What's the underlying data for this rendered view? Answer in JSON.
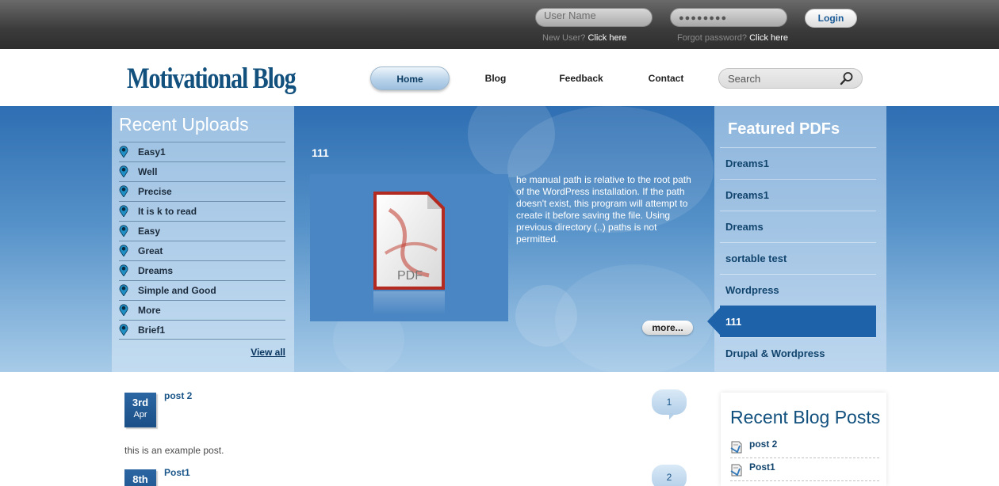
{
  "topbar": {
    "username_placeholder": "User Name",
    "password_mask": "●●●●●●●●",
    "login_label": "Login",
    "new_user_text": "New User?",
    "new_user_link": "Click here",
    "forgot_text": "Forgot password?",
    "forgot_link": "Click here"
  },
  "header": {
    "logo": "Motivational Blog",
    "nav": [
      "Home",
      "Blog",
      "Feedback",
      "Contact"
    ],
    "active_nav": "Home",
    "search_placeholder": "Search"
  },
  "recent_uploads": {
    "title": "Recent Uploads",
    "items": [
      "Easy1",
      "Well",
      "Precise",
      "It is k to read",
      "Easy",
      "Great",
      "Dreams",
      "Simple and Good",
      "More",
      "Brief1"
    ],
    "view_all": "View all"
  },
  "feature": {
    "title": "111",
    "pdf_icon_label": "PDF",
    "text": "he manual path is relative to the root path of the WordPress installation. If the path doesn't exist, this program will attempt to create it before saving the file. Using previous directory (..) paths is not permitted.",
    "more": "more..."
  },
  "featured_pdfs": {
    "title": "Featured PDFs",
    "items": [
      "Dreams1",
      "Dreams1",
      "Dreams",
      "sortable test",
      "Wordpress",
      "111",
      "Drupal & Wordpress"
    ],
    "active_index": 5
  },
  "posts": [
    {
      "day": "3rd",
      "month": "Apr",
      "title": "post 2",
      "comments": "1",
      "excerpt": "this is an example post."
    },
    {
      "day": "8th",
      "month": "",
      "title": "Post1",
      "comments": "2"
    }
  ],
  "recent_blog_posts": {
    "title": "Recent Blog Posts",
    "items": [
      "post 2",
      "Post1"
    ]
  },
  "colors": {
    "brand_blue": "#12507e",
    "active_pdf": "#1e62a9",
    "topbar": "#3b3b3b"
  }
}
